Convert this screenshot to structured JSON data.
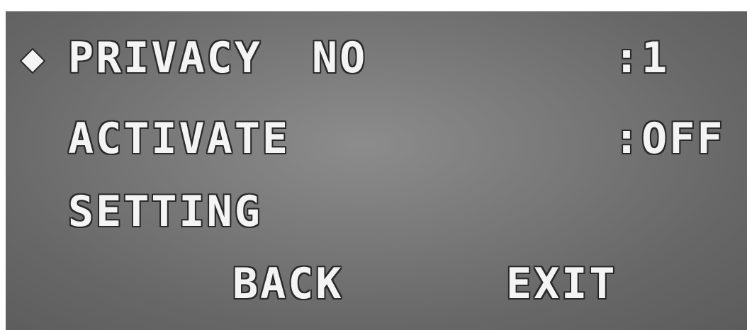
{
  "menu": {
    "cursor_icon": "diamond-selector-icon",
    "rows": [
      {
        "label": "PRIVACY",
        "sub": "NO",
        "value": ":1"
      },
      {
        "label": "ACTIVATE",
        "value": ":OFF"
      },
      {
        "label": "SETTING"
      }
    ],
    "back_label": "BACK",
    "exit_label": "EXIT"
  },
  "colors": {
    "text": "#f4f4f4",
    "outline": "#2a2a2a",
    "background": "#7a7a7a"
  }
}
